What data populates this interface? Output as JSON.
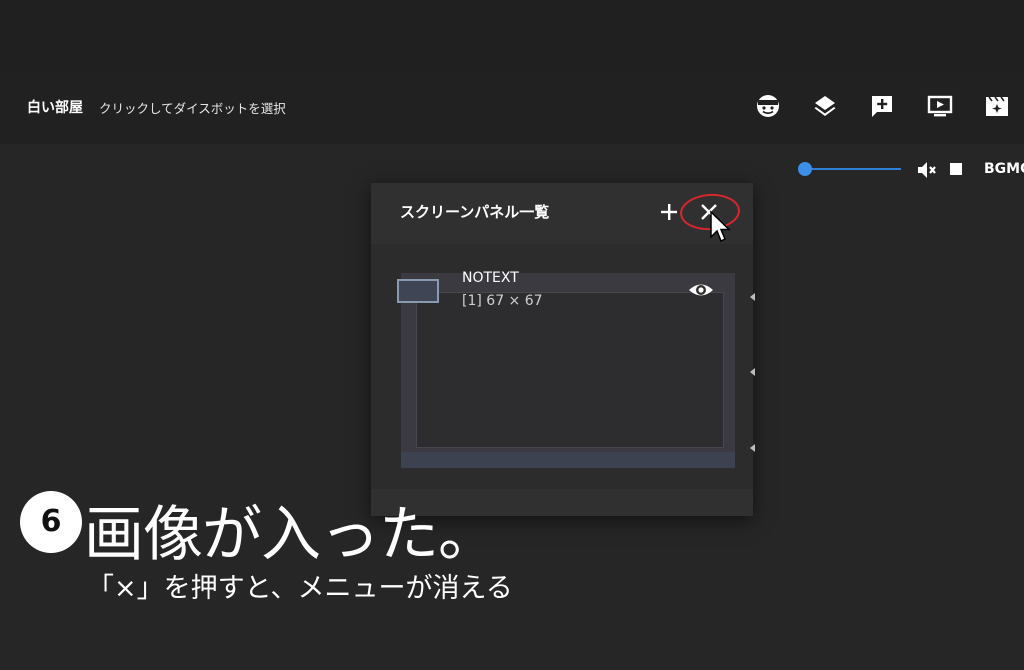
{
  "header": {
    "room_name": "白い部屋",
    "hint": "クリックしてダイスボットを選択",
    "icons": [
      "face-icon",
      "layers-icon",
      "add-comment-icon",
      "screen-icon",
      "scene-icon"
    ]
  },
  "audio": {
    "volume": 0.0,
    "bgm_label": "BGMC"
  },
  "panel": {
    "title": "スクリーンパネル一覧",
    "items": [
      {
        "name": "NOTEXT",
        "sub": "[1] 67 × 67"
      }
    ]
  },
  "caption": {
    "step": "6",
    "main": "画像が入った。",
    "sub": "「×」を押すと、メニューが消える"
  },
  "colors": {
    "background": "#262626",
    "appbar": "#212121",
    "panel": "#303030",
    "accent": "#3b8fe6",
    "highlight_ring": "#d9262e"
  }
}
